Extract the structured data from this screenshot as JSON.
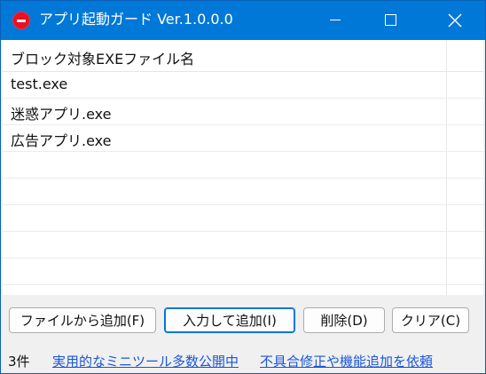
{
  "window": {
    "title": "アプリ起動ガード Ver.1.0.0.0"
  },
  "list": {
    "header": "ブロック対象EXEファイル名",
    "items": [
      "test.exe",
      "迷惑アプリ.exe",
      "広告アプリ.exe"
    ]
  },
  "toolbar": {
    "add_from_file": "ファイルから追加(F)",
    "add_by_input": "入力して追加(I)",
    "delete": "削除(D)",
    "clear": "クリア(C)"
  },
  "status": {
    "count": "3件",
    "link_tools": "実用的なミニツール多数公開中",
    "link_request": "不具合修正や機能追加を依頼"
  },
  "colors": {
    "titlebar": "#0078d7",
    "link": "#1a56db",
    "icon": "#e81123"
  }
}
